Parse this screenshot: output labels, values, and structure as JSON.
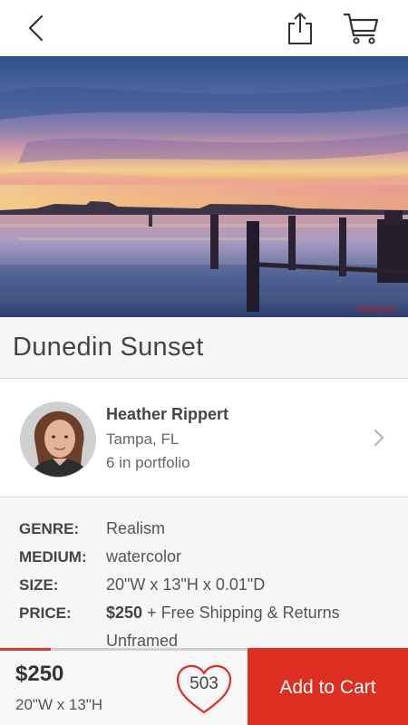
{
  "nav": {
    "back_icon": "chevron-left-icon",
    "share_icon": "share-icon",
    "cart_icon": "cart-icon"
  },
  "artwork": {
    "title": "Dunedin Sunset",
    "signature": "RIPPERT"
  },
  "artist": {
    "name": "Heather Rippert",
    "location": "Tampa, FL",
    "portfolio": "6 in portfolio"
  },
  "details": {
    "genre_label": "GENRE:",
    "genre": "Realism",
    "medium_label": "MEDIUM:",
    "medium": "watercolor",
    "size_label": "SIZE:",
    "size": "20\"W x 13\"H x 0.01\"D",
    "price_label": "PRICE:",
    "price": "$250",
    "price_extra": "+ Free Shipping & Returns",
    "framing": "Unframed"
  },
  "bottom": {
    "price": "$250",
    "size": "20\"W x 13\"H",
    "favorites": "503",
    "add_to_cart": "Add to Cart",
    "progress_fraction": 0.125
  },
  "colors": {
    "accent": "#dc2f22",
    "progress": "#e33a2c"
  }
}
